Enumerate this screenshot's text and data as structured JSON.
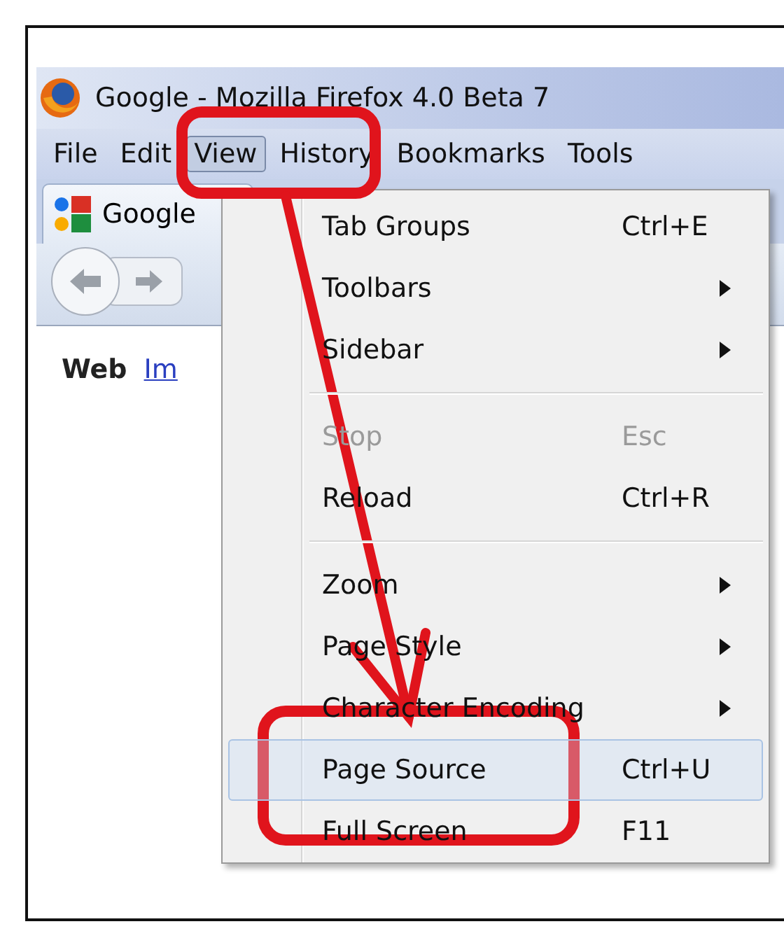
{
  "window": {
    "title": "Google - Mozilla Firefox 4.0 Beta 7"
  },
  "menubar": [
    {
      "label": "File",
      "selected": false
    },
    {
      "label": "Edit",
      "selected": false
    },
    {
      "label": "View",
      "selected": true
    },
    {
      "label": "History",
      "selected": false
    },
    {
      "label": "Bookmarks",
      "selected": false
    },
    {
      "label": "Tools",
      "selected": false
    }
  ],
  "tab": {
    "label": "Google"
  },
  "search_nav": [
    {
      "label": "Web",
      "kind": "current"
    },
    {
      "label": "Im",
      "kind": "link"
    }
  ],
  "view_menu": [
    {
      "kind": "item",
      "label": "Tab Groups",
      "shortcut": "Ctrl+E",
      "submenu": false,
      "disabled": false,
      "selected": false
    },
    {
      "kind": "item",
      "label": "Toolbars",
      "submenu": true,
      "disabled": false,
      "selected": false
    },
    {
      "kind": "item",
      "label": "Sidebar",
      "submenu": true,
      "disabled": false,
      "selected": false
    },
    {
      "kind": "separator"
    },
    {
      "kind": "item",
      "label": "Stop",
      "shortcut": "Esc",
      "submenu": false,
      "disabled": true,
      "selected": false
    },
    {
      "kind": "item",
      "label": "Reload",
      "shortcut": "Ctrl+R",
      "submenu": false,
      "disabled": false,
      "selected": false
    },
    {
      "kind": "separator"
    },
    {
      "kind": "item",
      "label": "Zoom",
      "submenu": true,
      "disabled": false,
      "selected": false
    },
    {
      "kind": "item",
      "label": "Page Style",
      "submenu": true,
      "disabled": false,
      "selected": false
    },
    {
      "kind": "item",
      "label": "Character Encoding",
      "submenu": true,
      "disabled": false,
      "selected": false
    },
    {
      "kind": "item",
      "label": "Page Source",
      "shortcut": "Ctrl+U",
      "submenu": false,
      "disabled": false,
      "selected": true
    },
    {
      "kind": "item",
      "label": "Full Screen",
      "shortcut": "F11",
      "submenu": false,
      "disabled": false,
      "selected": false
    }
  ]
}
